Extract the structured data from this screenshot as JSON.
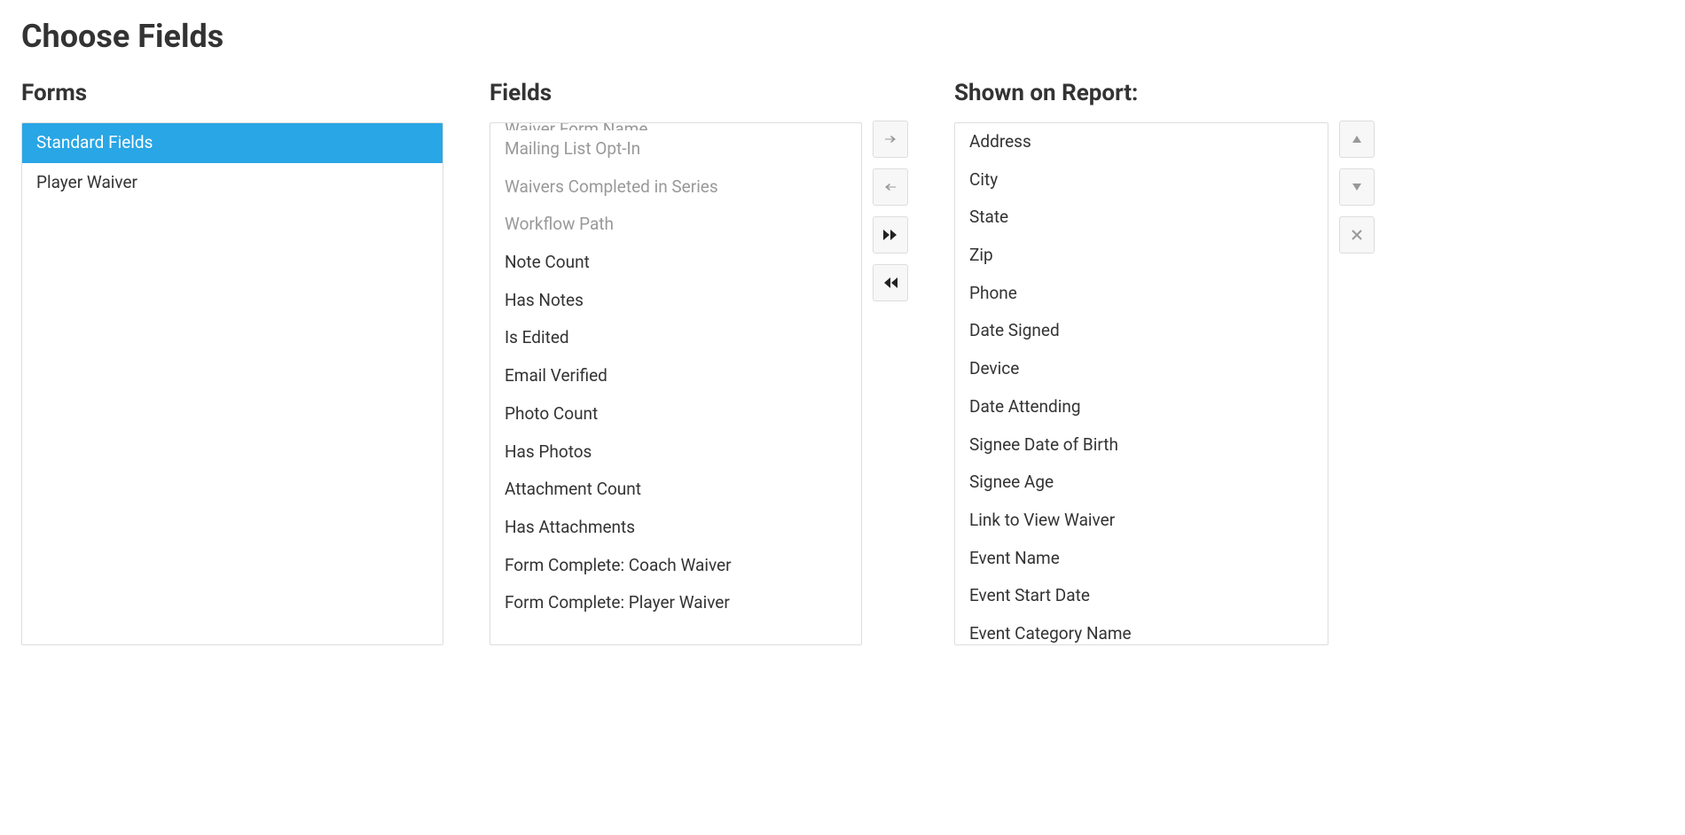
{
  "page_title": "Choose Fields",
  "columns": {
    "forms": {
      "title": "Forms",
      "items": [
        {
          "label": "Standard Fields",
          "selected": true
        },
        {
          "label": "Player Waiver",
          "selected": false
        }
      ]
    },
    "fields": {
      "title": "Fields",
      "cut_item": "Waiver Form Name",
      "items": [
        {
          "label": "Mailing List Opt-In",
          "disabled": true
        },
        {
          "label": "Waivers Completed in Series",
          "disabled": true
        },
        {
          "label": "Workflow Path",
          "disabled": true
        },
        {
          "label": "Note Count",
          "disabled": false
        },
        {
          "label": "Has Notes",
          "disabled": false
        },
        {
          "label": "Is Edited",
          "disabled": false
        },
        {
          "label": "Email Verified",
          "disabled": false
        },
        {
          "label": "Photo Count",
          "disabled": false
        },
        {
          "label": "Has Photos",
          "disabled": false
        },
        {
          "label": "Attachment Count",
          "disabled": false
        },
        {
          "label": "Has Attachments",
          "disabled": false
        },
        {
          "label": "Form Complete: Coach Waiver",
          "disabled": false
        },
        {
          "label": "Form Complete: Player Waiver",
          "disabled": false
        }
      ]
    },
    "shown": {
      "title": "Shown on Report:",
      "items": [
        {
          "label": "Address"
        },
        {
          "label": "City"
        },
        {
          "label": "State"
        },
        {
          "label": "Zip"
        },
        {
          "label": "Phone"
        },
        {
          "label": "Date Signed"
        },
        {
          "label": "Device"
        },
        {
          "label": "Date Attending"
        },
        {
          "label": "Signee Date of Birth"
        },
        {
          "label": "Signee Age"
        },
        {
          "label": "Link to View Waiver"
        },
        {
          "label": "Event Name"
        },
        {
          "label": "Event Start Date"
        },
        {
          "label": "Event Category Name"
        }
      ]
    }
  },
  "buttons": {
    "add": "arrow-right",
    "remove": "arrow-left",
    "add_all": "fast-forward",
    "remove_all": "fast-backward",
    "move_up": "triangle-up",
    "move_down": "triangle-down",
    "delete": "close"
  }
}
